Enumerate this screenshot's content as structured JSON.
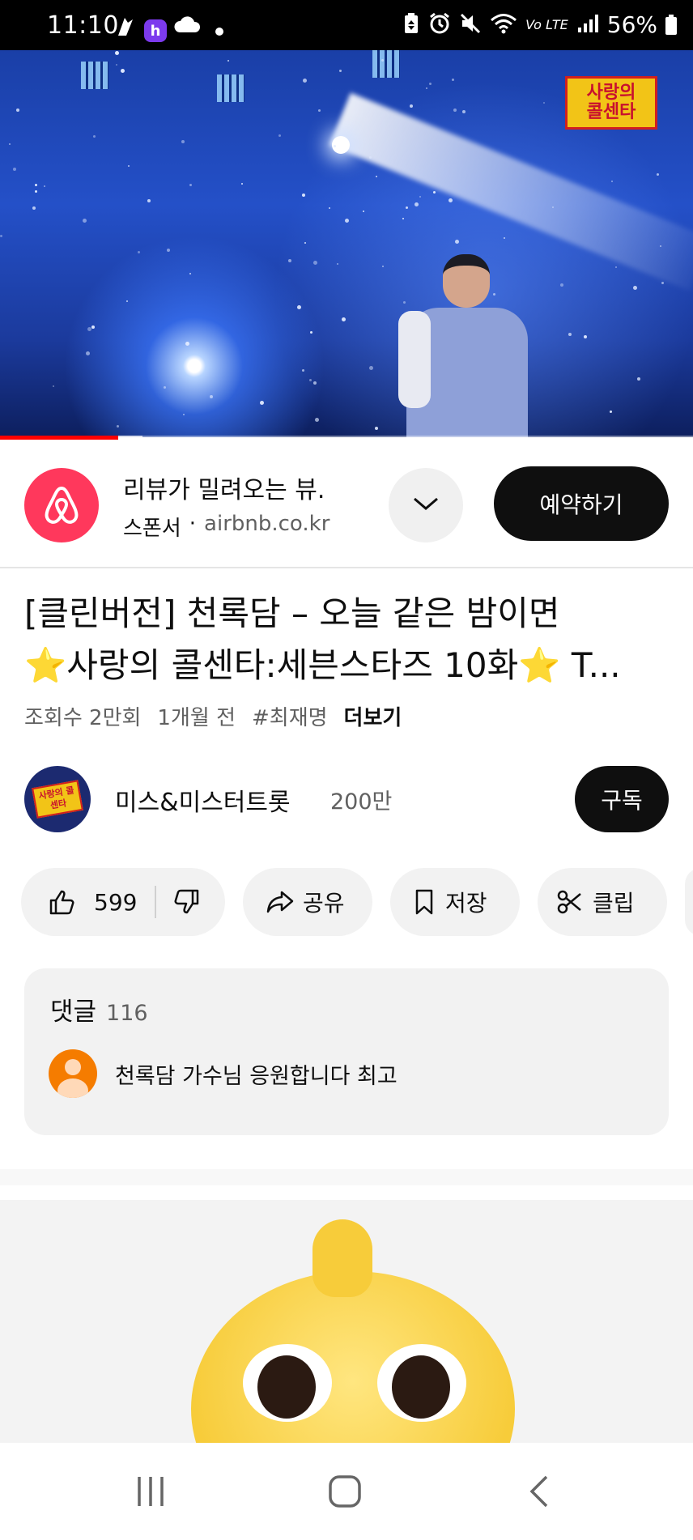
{
  "status_bar": {
    "time": "11:10",
    "battery": "56%",
    "icons": [
      "gesture-icon",
      "h-app-icon",
      "cloud-icon",
      "dot-icon",
      "battery-saver-icon",
      "alarm-icon",
      "mute-icon",
      "wifi-icon",
      "volte-icon",
      "signal-icon",
      "battery-icon"
    ]
  },
  "video": {
    "logo_line1": "사랑의",
    "logo_line2": "콜센타",
    "progress_fraction": 0.17
  },
  "ad": {
    "title": "리뷰가 밀려오는 뷰.",
    "sponsor": "스폰서",
    "separator": "·",
    "domain": "airbnb.co.kr",
    "cta": "예약하기",
    "brand_color": "#ff385c"
  },
  "video_info": {
    "title_line1": "[클린버전] 천록담 – 오늘 같은 밤이면",
    "title_line2": "⭐사랑의 콜센타:세븐스타즈 10화⭐ T...",
    "views": "조회수 2만회",
    "age": "1개월 전",
    "hashtag": "#최재명",
    "more": "더보기"
  },
  "channel": {
    "name": "미스&미스터트롯",
    "subscribers": "200만",
    "subscribe": "구독",
    "avatar_text": "사랑의 콜센타"
  },
  "actions": {
    "likes": "599",
    "share": "공유",
    "save": "저장",
    "clip": "클립"
  },
  "comments": {
    "label": "댓글",
    "count": "116",
    "top_comment": "천록담 가수님 응원합니다 최고"
  },
  "nav": {
    "recent": "recent-apps-icon",
    "home": "home-icon",
    "back": "back-icon"
  }
}
